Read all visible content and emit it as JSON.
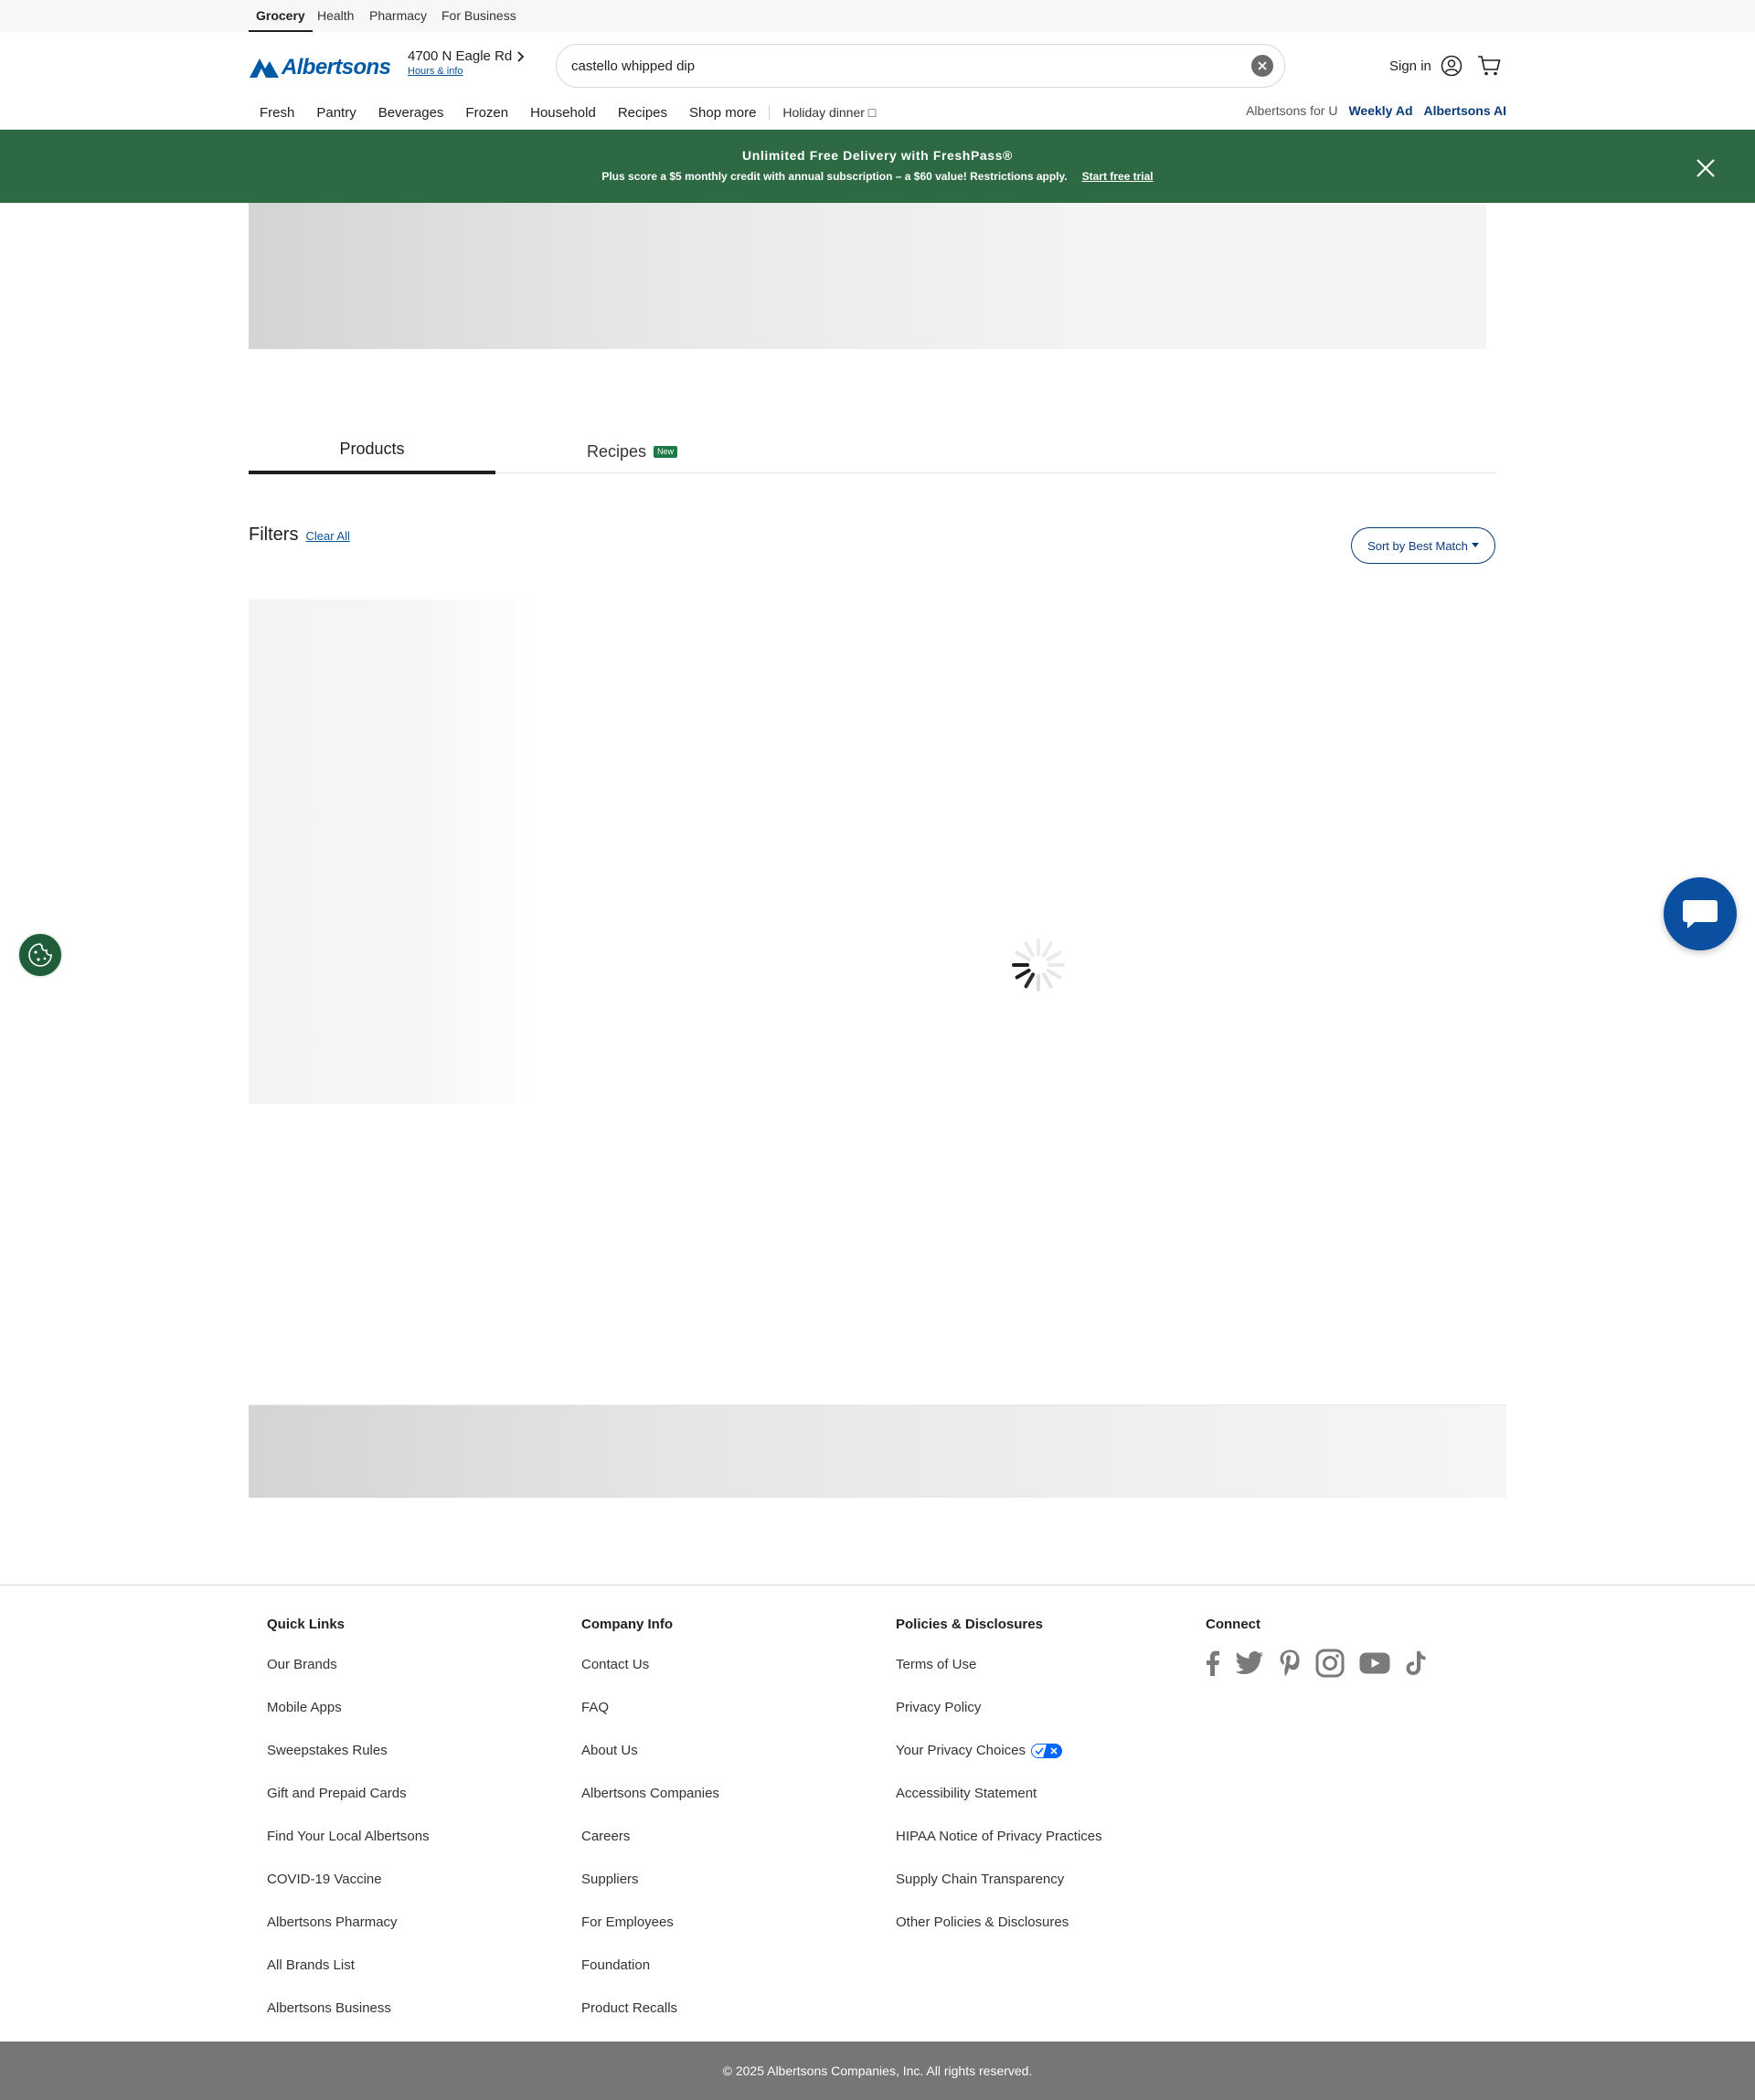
{
  "top_tabs": [
    {
      "label": "Grocery",
      "active": true
    },
    {
      "label": "Health",
      "active": false
    },
    {
      "label": "Pharmacy",
      "active": false
    },
    {
      "label": "For Business",
      "active": false
    }
  ],
  "brand": {
    "name": "Albertsons",
    "color": "#0059a5"
  },
  "store": {
    "address": "4700 N Eagle Rd",
    "hours_link": "Hours & info"
  },
  "search": {
    "value": "castello whipped dip"
  },
  "account": {
    "signin_label": "Sign in"
  },
  "nav": {
    "items": [
      "Fresh",
      "Pantry",
      "Beverages",
      "Frozen",
      "Household",
      "Recipes",
      "Shop more"
    ],
    "holiday": "Holiday dinner □",
    "right": [
      {
        "label": "Albertsons for U",
        "style": "muted"
      },
      {
        "label": "Weekly Ad",
        "style": "strong"
      },
      {
        "label": "Albertsons AI",
        "style": "strong"
      }
    ]
  },
  "promo": {
    "title": "Unlimited Free Delivery with FreshPass®",
    "subtitle": "Plus score a $5 monthly credit with annual subscription – a $60 value! Restrictions apply.",
    "cta": "Start free trial",
    "color": "#2d6a43"
  },
  "tabs": {
    "products": "Products",
    "recipes": "Recipes",
    "recipes_badge": "New"
  },
  "filters": {
    "title": "Filters",
    "clear_all": "Clear All",
    "sort_label": "Sort by Best Match"
  },
  "footer": {
    "columns": [
      {
        "title": "Quick Links",
        "links": [
          "Our Brands",
          "Mobile Apps",
          "Sweepstakes Rules",
          "Gift and Prepaid Cards",
          "Find Your Local Albertsons",
          "COVID-19 Vaccine",
          "Albertsons Pharmacy",
          "All Brands List",
          "Albertsons Business"
        ]
      },
      {
        "title": "Company Info",
        "links": [
          "Contact Us",
          "FAQ",
          "About Us",
          "Albertsons Companies",
          "Careers",
          "Suppliers",
          "For Employees",
          "Foundation",
          "Product Recalls"
        ]
      },
      {
        "title": "Policies & Disclosures",
        "links": [
          "Terms of Use",
          "Privacy Policy",
          "Your Privacy Choices",
          "Accessibility Statement",
          "HIPAA Notice of Privacy Practices",
          "Supply Chain Transparency",
          "Other Policies & Disclosures"
        ]
      }
    ],
    "connect": {
      "title": "Connect",
      "icons": [
        "facebook-icon",
        "twitter-icon",
        "pinterest-icon",
        "instagram-icon",
        "youtube-icon",
        "tiktok-icon"
      ]
    },
    "copyright": "© 2025 Albertsons Companies, Inc.  All rights reserved."
  }
}
